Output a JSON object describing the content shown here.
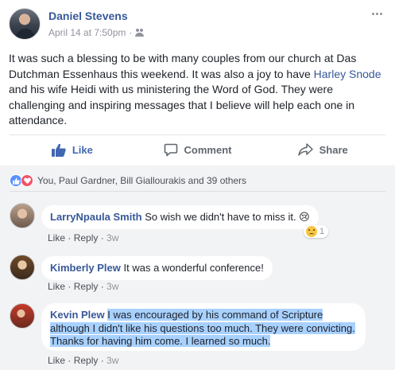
{
  "post": {
    "author": "Daniel Stevens",
    "date": "April 14 at 7:50pm",
    "dot": "·",
    "body_1": "It was such a blessing to be with many couples from our church at Das Dutchman Essenhaus this weekend. It was also a joy to have ",
    "mention": "Harley Snode",
    "body_2": " and his wife Heidi with us ministering the Word of God. They were challenging and inspiring messages that I believe will help each one in attendance."
  },
  "actions": {
    "like": "Like",
    "comment": "Comment",
    "share": "Share"
  },
  "reactions": {
    "summary": "You, Paul Gardner, Bill Giallourakis and 39 others"
  },
  "comments": [
    {
      "name": "LarryNpaula Smith",
      "text": "So wish we didn't have to miss it. 😢",
      "reaction_count": "1",
      "like": "Like",
      "reply": "Reply",
      "age": "3w",
      "sep": " · "
    },
    {
      "name": "Kimberly Plew",
      "text": "It was a wonderful conference!",
      "like": "Like",
      "reply": "Reply",
      "age": "3w",
      "sep": " · "
    },
    {
      "name": "Kevin Plew",
      "text": "I was encouraged by his command of Scripture although I didn't like his questions too much. They were convicting. Thanks for having him come. I learned so much.",
      "like": "Like",
      "reply": "Reply",
      "age": "3w",
      "sep": " · "
    }
  ],
  "colors": {
    "link": "#365899",
    "like_blue": "#4267b2",
    "selection": "#a8d1ff"
  }
}
